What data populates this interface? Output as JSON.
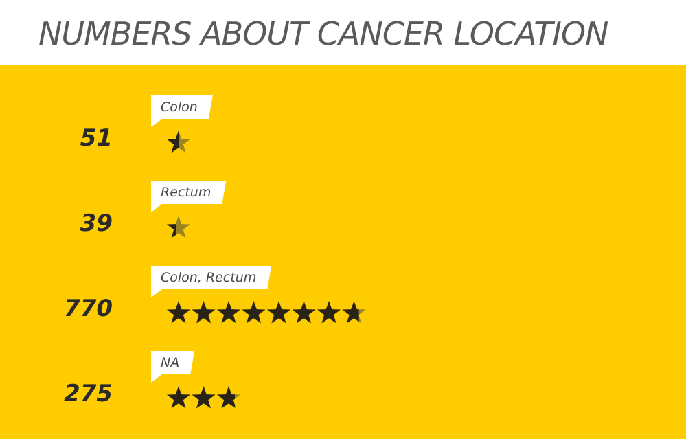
{
  "title": "NUMBERS ABOUT CANCER LOCATION",
  "colors": {
    "background": "#ffcc00",
    "star_filled": "#2a2418",
    "star_empty": "#9a8520",
    "tag": "#ffffff",
    "value_text": "#2a2a2a",
    "title_text": "#5a5a5a"
  },
  "chart_data": {
    "type": "pictograph",
    "icon": "star-icon",
    "units_per_icon": 100,
    "title": "NUMBERS ABOUT CANCER LOCATION",
    "categories": [
      "Colon",
      "Rectum",
      "Colon, Rectum",
      "NA"
    ],
    "values": [
      51,
      39,
      770,
      275
    ],
    "value_labels": [
      "51",
      "39",
      "770",
      "275"
    ]
  }
}
